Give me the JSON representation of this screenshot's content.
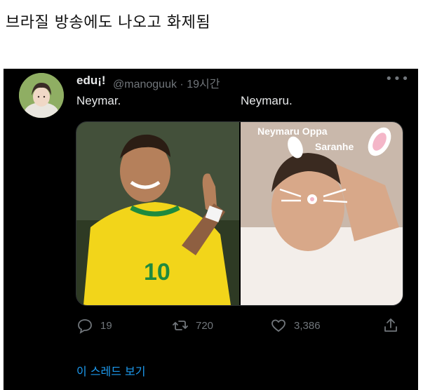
{
  "post": {
    "title": "브라질 방송에도 나오고 화제됨"
  },
  "tweet": {
    "display_name": "edu¡!",
    "handle": "@manoguuk",
    "separator": "·",
    "time": "19시간",
    "more_icon": "more-dots-icon",
    "caption_left": "Neymar.",
    "caption_right": "Neymaru.",
    "media": {
      "left_photo": "photo of soccer player in yellow jersey",
      "right_photo": "selfie with bunny-ear filter",
      "right_overlay_line1": "Neymaru Oppa",
      "right_overlay_line2": "Saranhe",
      "jersey_number": "10"
    },
    "actions": {
      "reply_count": "19",
      "retweet_count": "720",
      "like_count": "3,386"
    },
    "thread_link": "이 스레드 보기"
  },
  "colors": {
    "background": "#000000",
    "text": "#e7e9ea",
    "muted": "#71767b",
    "link": "#1d9bf0"
  }
}
